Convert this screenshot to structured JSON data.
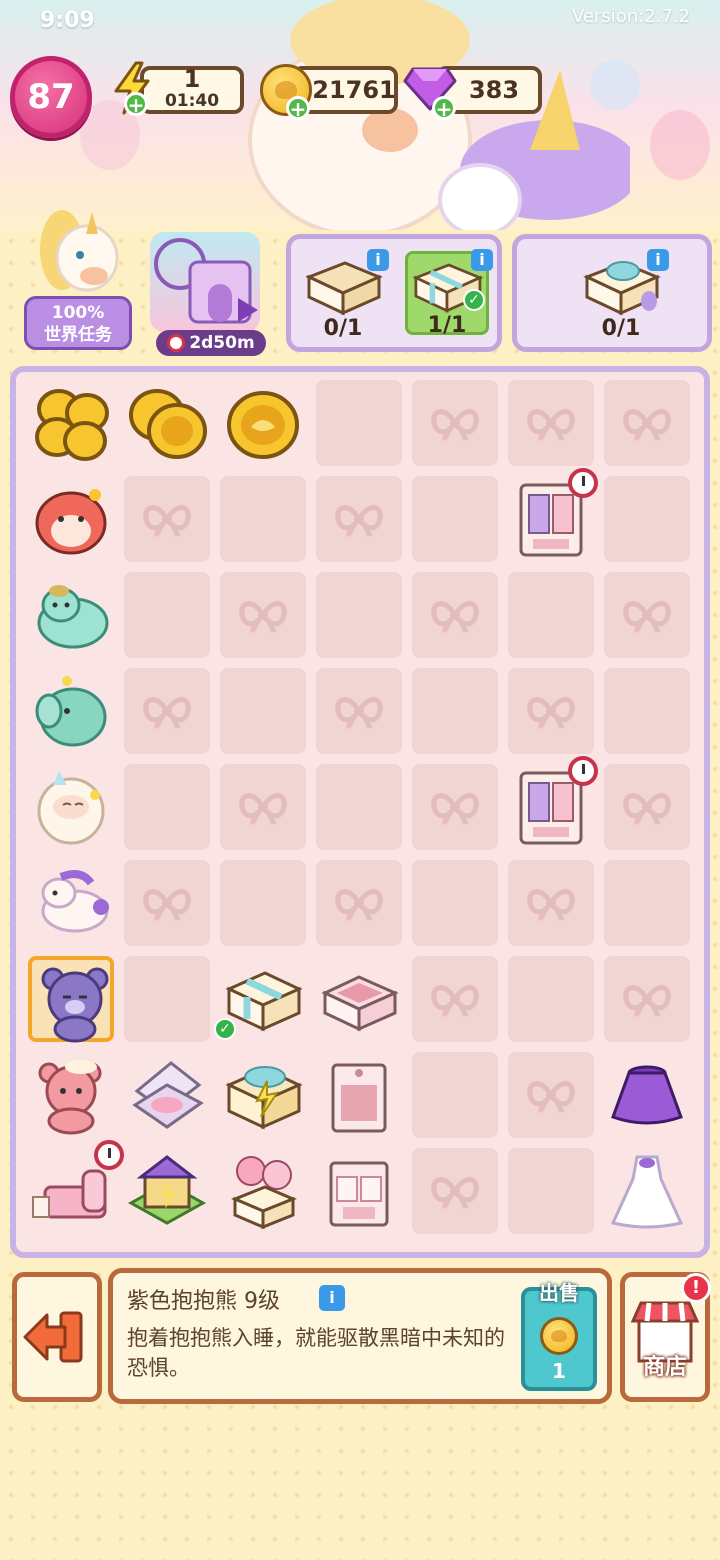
{
  "status_bar": {
    "time": "9:09",
    "right_text": "Version:2.7.2"
  },
  "header": {
    "level": "87",
    "energy": {
      "value": "1",
      "timer": "01:40"
    },
    "coins": "21761",
    "gems": "383"
  },
  "side": {
    "world_task_percent": "100%",
    "world_task_label": "世界任务",
    "event_timer": "2d50m"
  },
  "orders": [
    {
      "count": "0/1",
      "done": false
    },
    {
      "count": "1/1",
      "done": true
    },
    {
      "count": "0/1",
      "done": false
    }
  ],
  "info_panel": {
    "title": "紫色抱抱熊 9级",
    "description": "抱着抱抱熊入睡，就能驱散黑暗中未知的恐惧。",
    "sell_label": "出售",
    "sell_price": "1"
  },
  "shop_label": "商店",
  "shop_alert": "!",
  "board": {
    "cols": 7,
    "rows": 9,
    "cells": [
      [
        "coins3",
        "coins2",
        "coin1",
        "tile",
        "bow",
        "bow",
        "bow"
      ],
      [
        "hamster",
        "bow",
        "tile",
        "bow",
        "tile",
        "wardrobe",
        "tile"
      ],
      [
        "seal",
        "tile",
        "bow",
        "tile",
        "bow",
        "tile",
        "bow"
      ],
      [
        "elephant",
        "bow",
        "tile",
        "bow",
        "tile",
        "bow",
        "tile"
      ],
      [
        "sheep",
        "tile",
        "bow",
        "tile",
        "bow",
        "wardrobe",
        "bow"
      ],
      [
        "unicorn",
        "bow",
        "tile",
        "bow",
        "tile",
        "bow",
        "tile"
      ],
      [
        "purplebear",
        "tile",
        "giftbox",
        "drawer",
        "bow",
        "tile",
        "bow"
      ],
      [
        "pinkbear",
        "compact",
        "gift",
        "cabinet",
        "tile",
        "bow",
        "skirt"
      ],
      [
        "bed",
        "house",
        "balloongift",
        "dresser",
        "bow",
        "tile",
        "dress"
      ]
    ]
  },
  "colors": {
    "board_border": "#c9b2e6",
    "tile": "#f1d4d4",
    "accent_pink": "#d6307a",
    "sell_teal": "#4fc7cf"
  }
}
